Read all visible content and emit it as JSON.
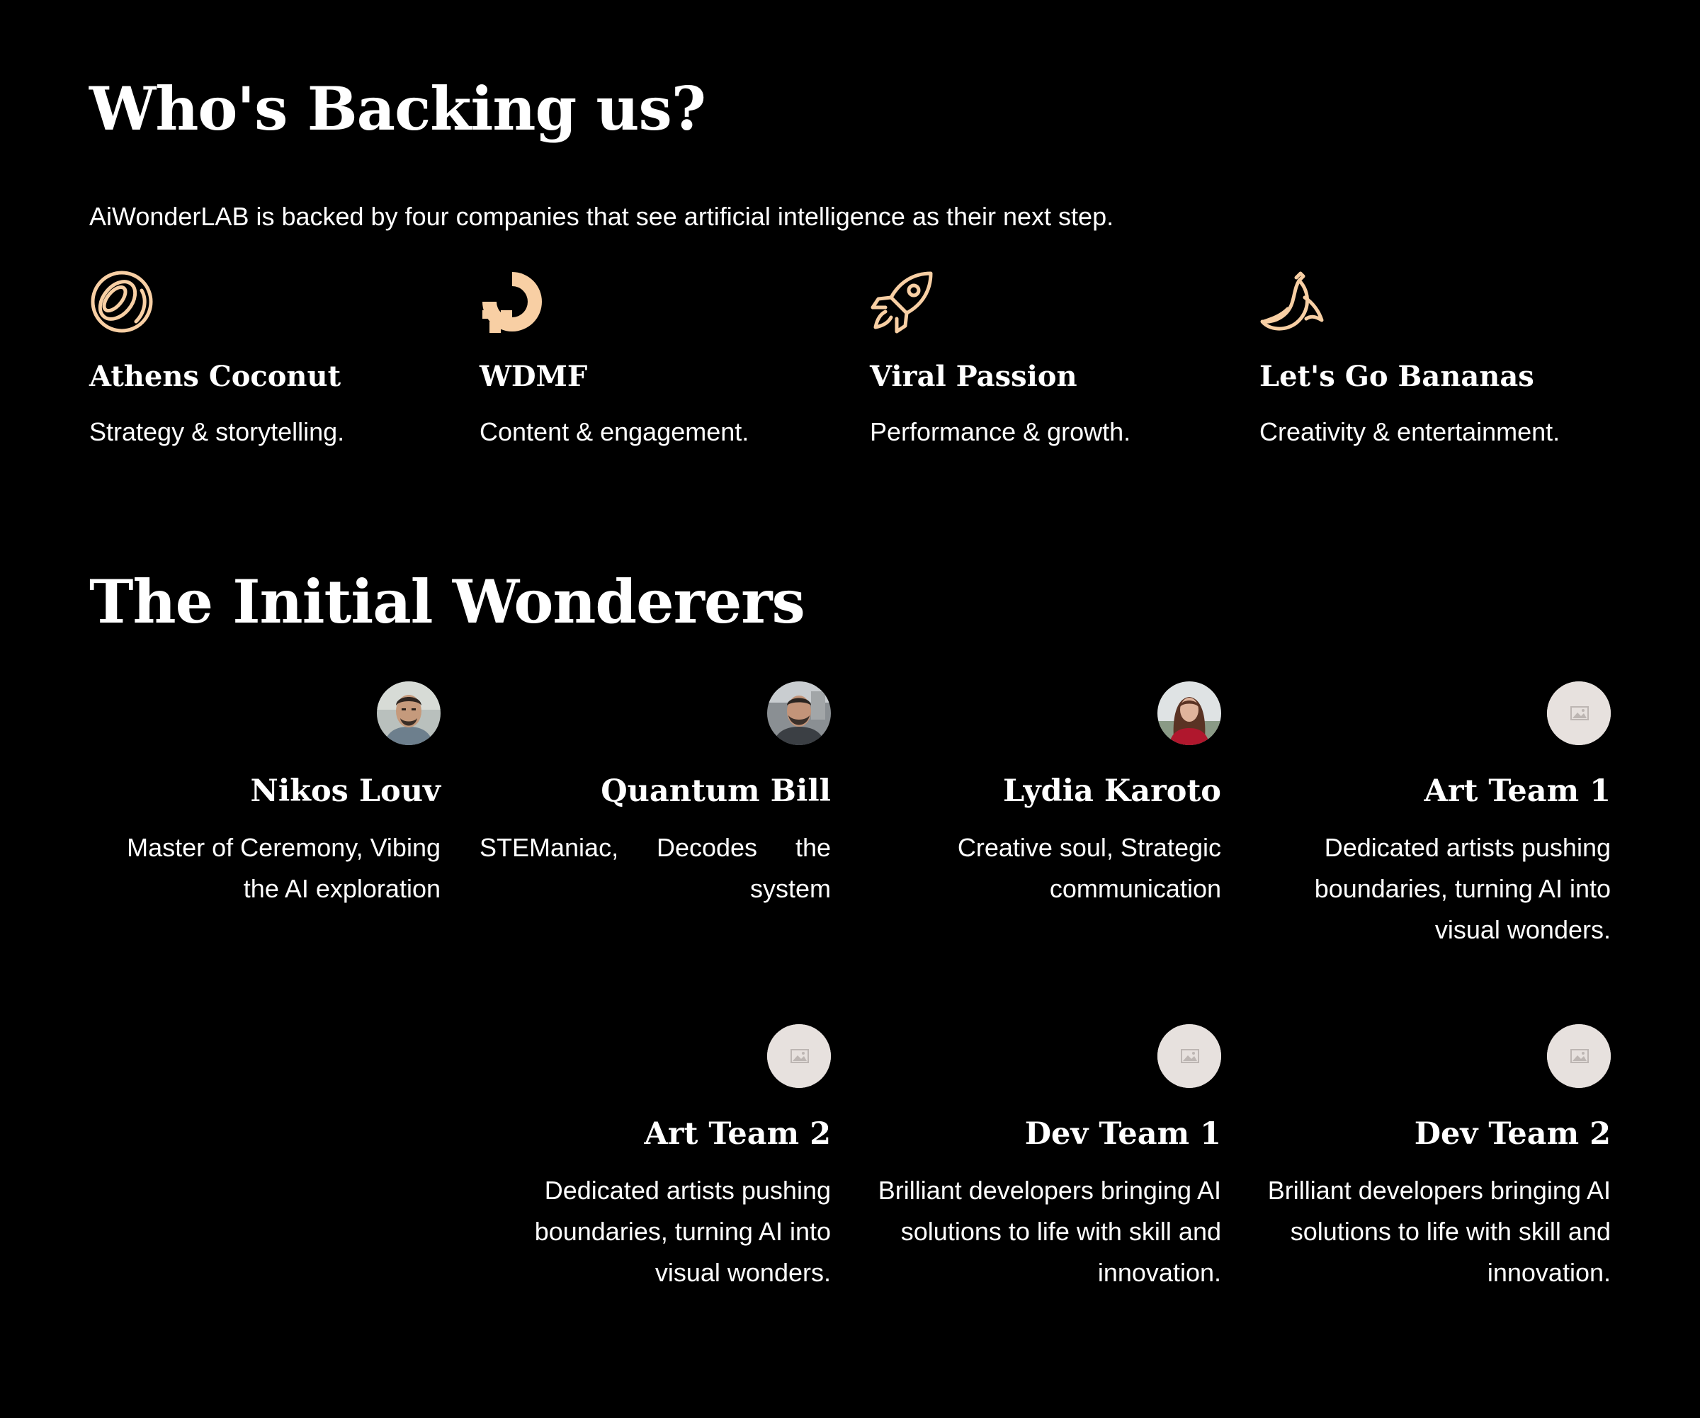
{
  "backers_section": {
    "title": "Who's Backing us?",
    "intro": "AiWonderLAB is backed by four companies that see artificial intelligence as their next step.",
    "accent_color": "#f8cfa4",
    "backers": [
      {
        "icon": "coconut-icon",
        "name": "Athens Coconut",
        "description": "Strategy & storytelling."
      },
      {
        "icon": "pixel-o-icon",
        "name": "WDMF",
        "description": "Content & engagement."
      },
      {
        "icon": "rocket-icon",
        "name": "Viral Passion",
        "description": "Performance & growth."
      },
      {
        "icon": "banana-icon",
        "name": "Let's Go Bananas",
        "description": "Creativity & entertainment."
      }
    ]
  },
  "team_section": {
    "title": "The Initial Wonderers",
    "members": [
      {
        "avatar": "photo",
        "name": "Nikos Louv",
        "description": "Master of Ceremony, Vibing the AI exploration"
      },
      {
        "avatar": "photo",
        "name": "Quantum Bill",
        "description": "STEManiac, Decodes the system"
      },
      {
        "avatar": "photo",
        "name": "Lydia Karoto",
        "description": "Creative soul, Strategic communication"
      },
      {
        "avatar": "image-placeholder-icon",
        "name": "Art Team 1",
        "description": "Dedicated artists pushing boundaries, turning AI into visual wonders."
      },
      {
        "avatar": "image-placeholder-icon",
        "name": "Art Team 2",
        "description": "Dedicated artists pushing boundaries, turning AI into visual wonders."
      },
      {
        "avatar": "image-placeholder-icon",
        "name": "Dev Team 1",
        "description": "Brilliant developers bringing AI solutions to life with skill and innovation."
      },
      {
        "avatar": "image-placeholder-icon",
        "name": "Dev Team 2",
        "description": "Brilliant developers bringing AI solutions to life with skill and innovation."
      }
    ]
  }
}
